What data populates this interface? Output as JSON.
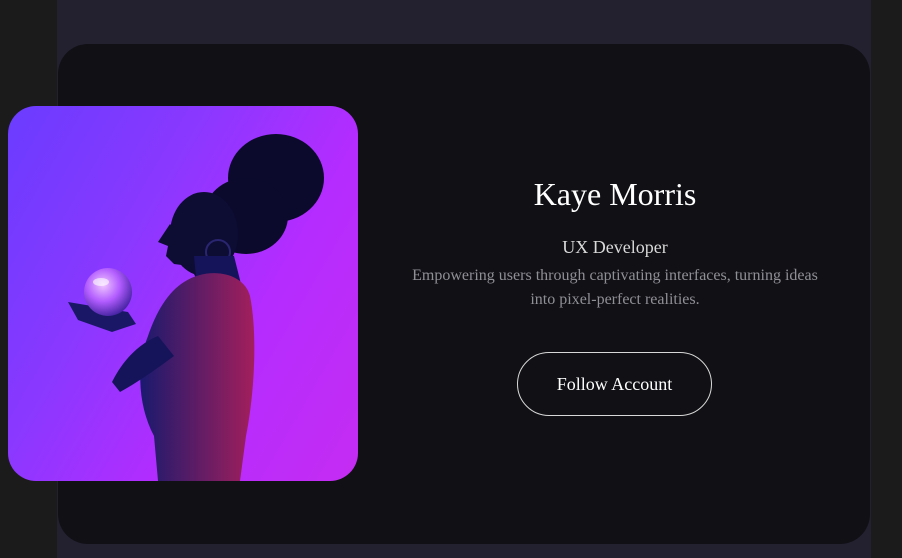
{
  "profile": {
    "name": "Kaye Morris",
    "role": "UX Developer",
    "bio": "Empowering users through captivating interfaces, turning ideas into pixel-perfect realities.",
    "follow_label": "Follow Account"
  },
  "colors": {
    "page_bg": "#1b1b1b",
    "stage_bg": "#232030",
    "card_bg": "#111015",
    "photo_gradient": [
      "#6a3cff",
      "#c52cf2"
    ],
    "text_primary": "#ffffff",
    "text_secondary": "#8f8f96"
  }
}
